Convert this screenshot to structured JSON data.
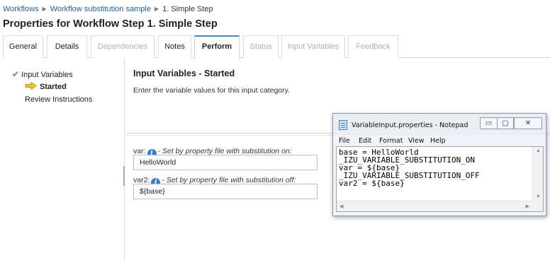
{
  "breadcrumb": {
    "items": [
      "Workflows",
      "Workflow substitution sample",
      "1. Simple Step"
    ]
  },
  "page_title": "Properties for Workflow Step 1. Simple Step",
  "tabs": [
    {
      "label": "General",
      "state": "normal"
    },
    {
      "label": "Details",
      "state": "normal"
    },
    {
      "label": "Dependencies",
      "state": "disabled"
    },
    {
      "label": "Notes",
      "state": "normal"
    },
    {
      "label": "Perform",
      "state": "active"
    },
    {
      "label": "Status",
      "state": "disabled"
    },
    {
      "label": "Input Variables",
      "state": "disabled"
    },
    {
      "label": "Feedback",
      "state": "disabled"
    }
  ],
  "left_nav": {
    "input_variables": "Input Variables",
    "started": "Started",
    "review_instructions": "Review Instructions"
  },
  "content": {
    "title": "Input Variables - Started",
    "description": "Enter the variable values for this input category."
  },
  "variables": [
    {
      "name": "var:",
      "description": "- Set by property file with substitution on:",
      "value": "HelloWorld"
    },
    {
      "name": "var2:",
      "description": "- Set by property file with substitution off:",
      "value": "${base}"
    }
  ],
  "notepad": {
    "title": "VariableInput.properties - Notepad",
    "menu": [
      "File",
      "Edit",
      "Format",
      "View",
      "Help"
    ],
    "lines": [
      "base = HelloWorld",
      "_IZU_VARIABLE_SUBSTITUTION_ON",
      "var = ${base}",
      "_IZU_VARIABLE_SUBSTITUTION_OFF",
      "var2 = ${base}"
    ],
    "buttons": {
      "minimize": "▭",
      "maximize": "▢",
      "close": "✕"
    }
  },
  "colors": {
    "link": "#1f5fb4",
    "active_tab_accent": "#3d8fd3",
    "check": "#3aa83a",
    "arrow": "#f2c227",
    "info": "#2f7fd6"
  }
}
